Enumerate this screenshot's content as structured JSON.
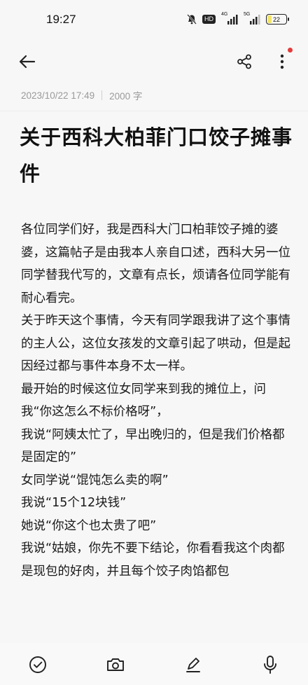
{
  "status_bar": {
    "time": "19:27",
    "hd_label": "HD",
    "signal1_label": "4G",
    "signal2_label": "5G",
    "battery": "22",
    "battery_level": 0.22,
    "icons": [
      "mute-bell-icon",
      "hd-icon",
      "signal-icon",
      "signal-icon",
      "battery-icon"
    ]
  },
  "toolbar": {
    "icons": [
      "back-arrow-icon",
      "share-icon",
      "more-vertical-icon"
    ],
    "notification_dot_color": "#e43b3b"
  },
  "meta": {
    "datetime": "2023/10/22 17:49",
    "word_count": "2000 字"
  },
  "article": {
    "title": "关于西科大柏菲门口饺子摊事件",
    "paragraphs": [
      "各位同学们好，我是西科大门口柏菲饺子摊的婆婆，这篇帖子是由我本人亲自口述，西科大另一位同学替我代写的，文章有点长，烦请各位同学能有耐心看完。",
      "关于昨天这个事情，今天有同学跟我讲了这个事情的主人公，这位女孩发的文章引起了哄动，但是起因经过都与事件本身不太一样。",
      "最开始的时候这位女同学来到我的摊位上，问我“你这怎么不标价格呀”，",
      "我说“阿姨太忙了，早出晚归的，但是我们价格都是固定的”",
      "女同学说“馄饨怎么卖的啊”",
      "我说“15个12块钱”",
      "她说“你这个也太贵了吧”",
      "我说“姑娘，你先不要下结论，你看看我这个肉都是现包的好肉，并且每个饺子肉馅都包"
    ]
  },
  "bottom_bar": {
    "icons": [
      "check-circle-icon",
      "camera-icon",
      "pen-icon",
      "microphone-icon"
    ]
  }
}
